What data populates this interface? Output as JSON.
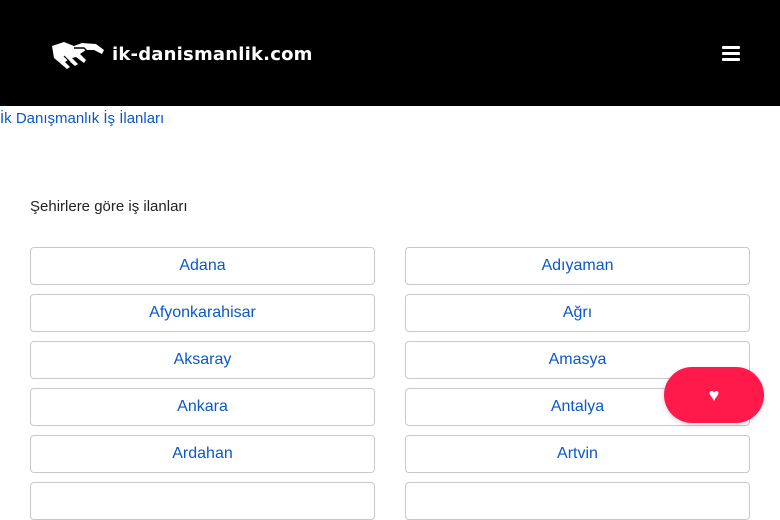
{
  "header": {
    "logo_text": "ik-danismanlik.com",
    "logo_icon": "handshake-icon",
    "menu_icon": "hamburger-menu-icon",
    "background": "#000000"
  },
  "breadcrumb": {
    "link_text": "İk Danışmanlık İş İlanları"
  },
  "section": {
    "heading": "Şehirlere göre iş ilanları"
  },
  "cities": [
    {
      "label": "Adana"
    },
    {
      "label": "Adıyaman"
    },
    {
      "label": "Afyonkarahisar"
    },
    {
      "label": "Ağrı"
    },
    {
      "label": "Aksaray"
    },
    {
      "label": "Amasya"
    },
    {
      "label": "Ankara"
    },
    {
      "label": "Antalya"
    },
    {
      "label": "Ardahan"
    },
    {
      "label": "Artvin"
    },
    {
      "label": ""
    },
    {
      "label": ""
    }
  ],
  "floating_button": {
    "icon": "heart-icon",
    "glyph": "♥",
    "color": "#ff1a4b"
  },
  "colors": {
    "link": "#0a58ca",
    "border": "#c9c9c9"
  }
}
